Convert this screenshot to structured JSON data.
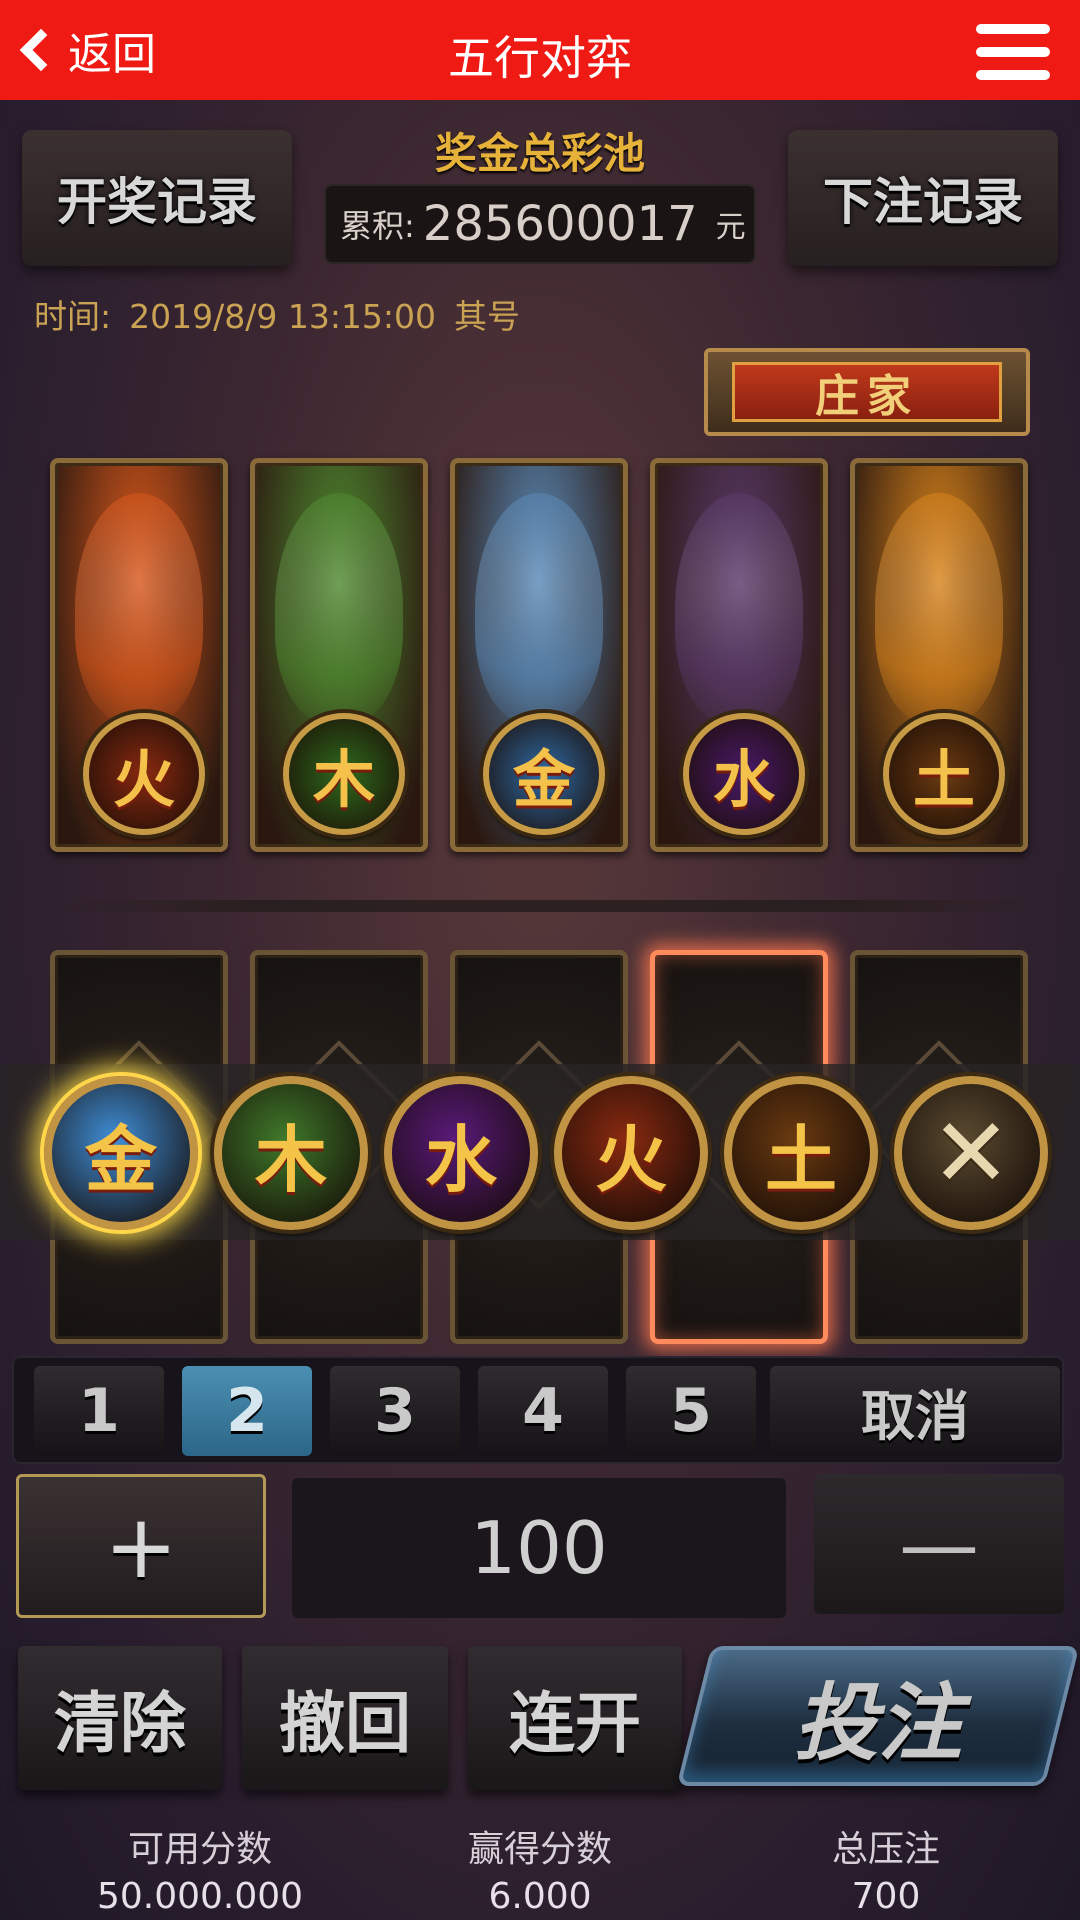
{
  "header": {
    "back_label": "返回",
    "title": "五行对弈"
  },
  "records": {
    "draw_record": "开奖记录",
    "bet_record": "下注记录"
  },
  "jackpot": {
    "title": "奖金总彩池",
    "label": "累积:",
    "amount": "285600017",
    "unit": "元"
  },
  "round": {
    "time_label": "时间:",
    "time": "2019/8/9  13:15:00",
    "issue_label": "其号"
  },
  "banker_label": "庄家",
  "top_cards": [
    {
      "element": "火",
      "creature": "phoenix",
      "color": "#d8581c",
      "emblem_bg": "#8a2a10"
    },
    {
      "element": "木",
      "creature": "green dragon",
      "color": "#4f8a30",
      "emblem_bg": "#2f6a1c"
    },
    {
      "element": "金",
      "creature": "white tiger",
      "color": "#5a8ab8",
      "emblem_bg": "#2f6aa4"
    },
    {
      "element": "水",
      "creature": "black tortoise",
      "color": "#5a3a6a",
      "emblem_bg": "#4a1a6a"
    },
    {
      "element": "土",
      "creature": "golden qilin",
      "color": "#d8841c",
      "emblem_bg": "#6a3a10"
    }
  ],
  "chips": [
    {
      "element": "金",
      "name": "chip-metal",
      "bg": "#3f8fd8",
      "active": true
    },
    {
      "element": "木",
      "name": "chip-wood",
      "bg": "#3f7a2a",
      "active": false
    },
    {
      "element": "水",
      "name": "chip-water",
      "bg": "#5a1a7a",
      "active": false
    },
    {
      "element": "火",
      "name": "chip-fire",
      "bg": "#8a2a10",
      "active": false
    },
    {
      "element": "土",
      "name": "chip-earth",
      "bg": "#6a3a10",
      "active": false
    },
    {
      "element": "✕",
      "name": "chip-cancel",
      "bg": "#5a4a30",
      "active": false
    }
  ],
  "selected_back_card": 4,
  "numbers": [
    "1",
    "2",
    "3",
    "4",
    "5"
  ],
  "active_number": "2",
  "cancel_label": "取消",
  "amount": {
    "plus": "+",
    "value": "100",
    "minus": "—"
  },
  "actions": {
    "clear": "清除",
    "undo": "撤回",
    "continuous": "连开",
    "bet": "投注"
  },
  "stats": {
    "available_label": "可用分数",
    "available": "50.000.000",
    "won_label": "赢得分数",
    "won": "6.000",
    "total_label": "总压注",
    "total": "700"
  }
}
